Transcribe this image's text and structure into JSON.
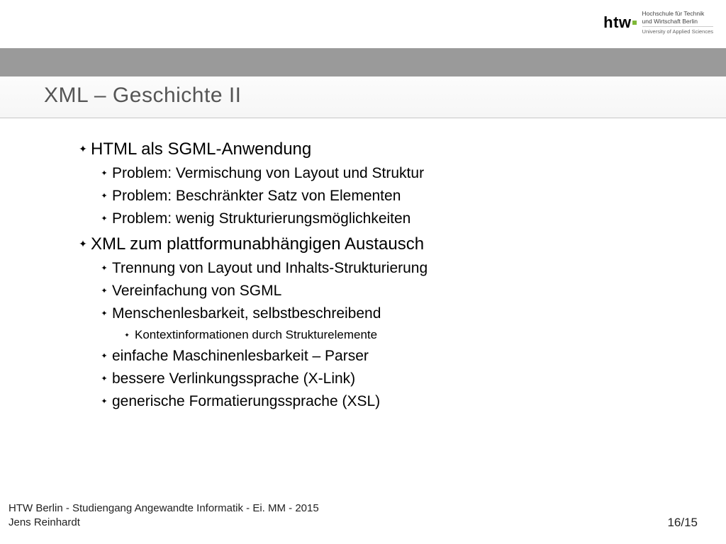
{
  "header": {
    "logo_main": "htw",
    "logo_line1": "Hochschule für Technik",
    "logo_line2": "und Wirtschaft Berlin",
    "logo_sub": "University of Applied Sciences"
  },
  "title": "XML – Geschichte II",
  "items": {
    "a": "HTML als SGML-Anwendung",
    "a1": "Problem: Vermischung von Layout und Struktur",
    "a2": "Problem: Beschränkter Satz von Elementen",
    "a3": "Problem: wenig Strukturierungsmöglichkeiten",
    "b": "XML zum plattformunabhängigen Austausch",
    "b1": "Trennung von Layout und Inhalts-Strukturierung",
    "b2": "Vereinfachung von SGML",
    "b3": "Menschenlesbarkeit, selbstbeschreibend",
    "b3a": "Kontextinformationen durch Strukturelemente",
    "b4": "einfache Maschinenlesbarkeit – Parser",
    "b5": "bessere Verlinkungssprache (X-Link)",
    "b6": "generische Formatierungssprache (XSL)"
  },
  "footer": {
    "line1": "HTW Berlin - Studiengang Angewandte Informatik - Ei. MM - 2015",
    "line2": "Jens Reinhardt",
    "page": "16/15"
  }
}
